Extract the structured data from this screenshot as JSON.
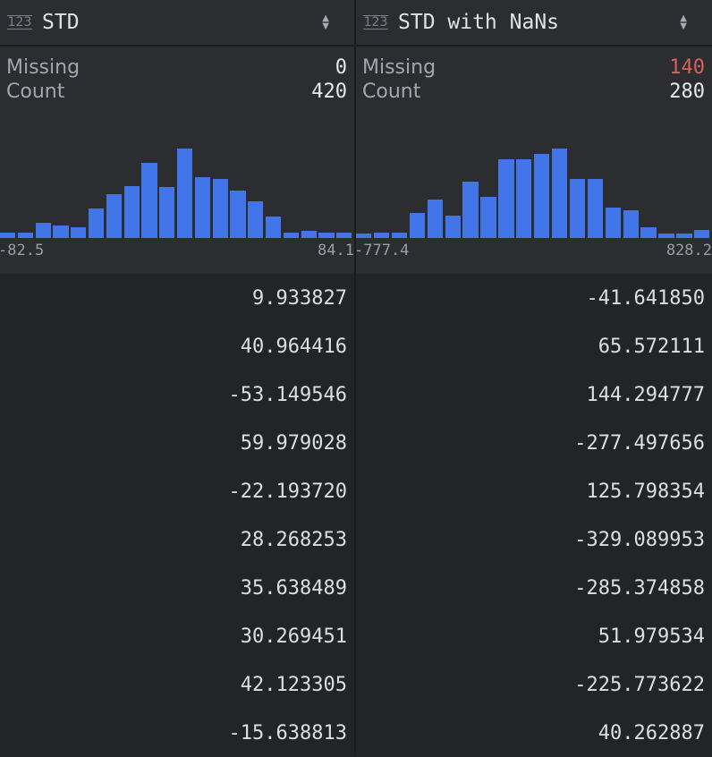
{
  "columns": [
    {
      "type_icon": "123",
      "title": "STD",
      "missing_label": "Missing",
      "missing": "0",
      "count_label": "Count",
      "count": "420",
      "histogram": {
        "min": "-82.5",
        "max": "84.1",
        "counts": [
          6,
          6,
          17,
          14,
          12,
          33,
          49,
          58,
          84,
          57,
          100,
          68,
          66,
          53,
          41,
          24,
          6,
          8,
          6,
          6
        ]
      },
      "values": [
        "9.933827",
        "40.964416",
        "-53.149546",
        "59.979028",
        "-22.193720",
        "28.268253",
        "35.638489",
        "30.269451",
        "42.123305",
        "-15.638813"
      ]
    },
    {
      "type_icon": "123",
      "title": "STD with NaNs",
      "missing_label": "Missing",
      "missing": "140",
      "count_label": "Count",
      "count": "280",
      "histogram": {
        "min": "-777.4",
        "max": "828.2",
        "counts": [
          5,
          6,
          6,
          28,
          43,
          25,
          62,
          46,
          87,
          87,
          93,
          99,
          65,
          65,
          34,
          31,
          12,
          5,
          5,
          9
        ]
      },
      "values": [
        "-41.641850",
        "65.572111",
        "144.294777",
        "-277.497656",
        "125.798354",
        "-329.089953",
        "-285.374858",
        "51.979534",
        "-225.773622",
        "40.262887"
      ]
    }
  ],
  "colors": {
    "bar": "#4175e8",
    "missing_nonzero": "#d9605a"
  }
}
